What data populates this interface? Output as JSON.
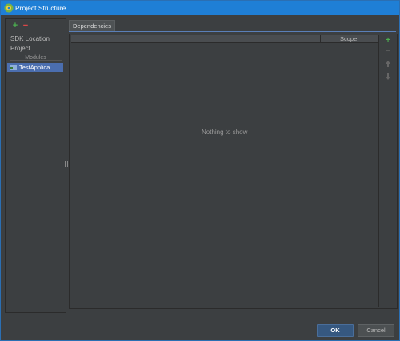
{
  "window": {
    "title": "Project Structure",
    "icon": "android-studio-icon"
  },
  "sidebar": {
    "toolbar": {
      "add_label": "+",
      "remove_label": "−"
    },
    "items": [
      {
        "label": "SDK Location"
      },
      {
        "label": "Project"
      }
    ],
    "section_label": "Modules",
    "modules": [
      {
        "label": "TestApplica...",
        "icon": "module-folder-icon",
        "selected": true
      }
    ]
  },
  "main": {
    "tabs": [
      {
        "label": "Dependencies",
        "active": true
      }
    ],
    "table": {
      "columns": [
        "",
        "Scope"
      ],
      "empty_text": "Nothing to show"
    },
    "side_toolbar": {
      "add_label": "+",
      "remove_label": "−"
    }
  },
  "footer": {
    "ok_label": "OK",
    "cancel_label": "Cancel"
  },
  "colors": {
    "titlebar": "#1f7fd6",
    "background": "#3c3f41",
    "selection": "#4b6eaf",
    "add_green": "#4caf50",
    "remove_red": "#e04848",
    "ok_button": "#365880"
  }
}
